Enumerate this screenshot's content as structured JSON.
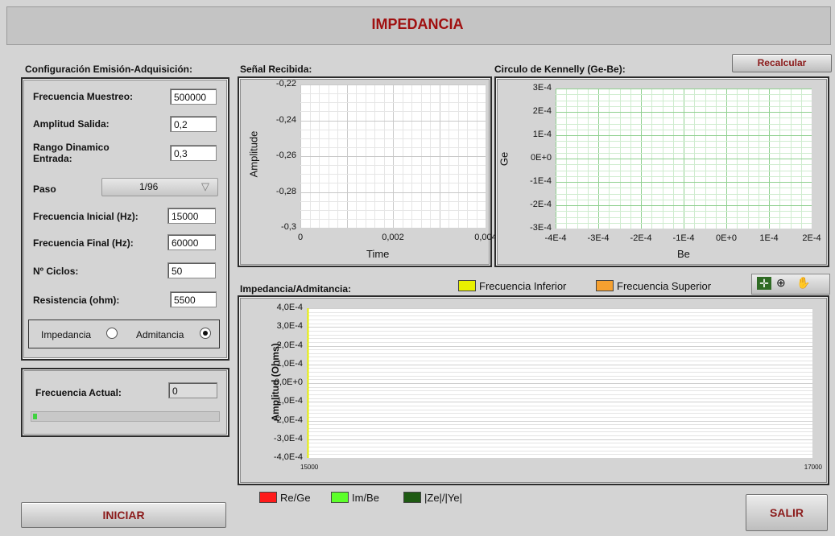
{
  "header": {
    "title": "IMPEDANCIA"
  },
  "config": {
    "title": "Configuración Emisión-Adquisición:",
    "fields": [
      {
        "label": "Frecuencia Muestreo:",
        "value": "500000"
      },
      {
        "label": "Amplitud Salida:",
        "value": "0,2"
      },
      {
        "label": "Rango Dinamico Entrada:",
        "value": "0,3"
      },
      {
        "label": "Paso",
        "value": "1/96"
      },
      {
        "label": "Frecuencia Inicial (Hz):",
        "value": "15000"
      },
      {
        "label": "Frecuencia Final (Hz):",
        "value": "60000"
      },
      {
        "label": "Nº Ciclos:",
        "value": "50"
      },
      {
        "label": "Resistencia (ohm):",
        "value": "5500"
      }
    ],
    "radio_impedancia": "Impedancia",
    "radio_admitancia": "Admitancia",
    "selected_mode": "Admitancia"
  },
  "freq_actual": {
    "label": "Frecuencia Actual:",
    "value": "0",
    "progress": 0.02
  },
  "signal_chart": {
    "title": "Señal Recibida:",
    "ylabel": "Amplitude",
    "xlabel": "Time",
    "yticks": [
      "-0,22",
      "-0,24",
      "-0,26",
      "-0,28",
      "-0,3"
    ],
    "xticks": [
      "0",
      "0,002",
      "0,004"
    ]
  },
  "kennelly_chart": {
    "title": "Circulo de Kennelly (Ge-Be):",
    "ylabel": "Ge",
    "xlabel": "Be",
    "yticks": [
      "3E-4",
      "2E-4",
      "1E-4",
      "0E+0",
      "-1E-4",
      "-2E-4",
      "-3E-4"
    ],
    "xticks": [
      "-4E-4",
      "-3E-4",
      "-2E-4",
      "-1E-4",
      "0E+0",
      "1E-4",
      "2E-4"
    ]
  },
  "recalcular_label": "Recalcular",
  "impedance_chart": {
    "title": "Impedancia/Admitancia:",
    "ylabel": "Amplitud (Ohms)",
    "yticks": [
      "4,0E-4",
      "3,0E-4",
      "2,0E-4",
      "1,0E-4",
      "0,0E+0",
      "-1,0E-4",
      "-2,0E-4",
      "-3,0E-4",
      "-4,0E-4"
    ],
    "xticks": [
      "15000",
      "17000"
    ],
    "legend_top": [
      {
        "name": "Frecuencia Inferior",
        "color": "#e8f000"
      },
      {
        "name": "Frecuencia Superior",
        "color": "#f5a030"
      }
    ],
    "legend_bottom": [
      {
        "name": "Re/Ge",
        "color": "#ff1a1a"
      },
      {
        "name": "Im/Be",
        "color": "#5cff2a"
      },
      {
        "name": "|Ze|/|Ye|",
        "color": "#1e5a12"
      }
    ]
  },
  "chart_data": [
    {
      "type": "line",
      "title": "",
      "xlabel": "Time",
      "ylabel": "Amplitude",
      "xlim": [
        0,
        0.004
      ],
      "ylim": [
        -0.3,
        -0.22
      ],
      "series": [],
      "grid": true
    },
    {
      "type": "scatter",
      "title": "",
      "xlabel": "Be",
      "ylabel": "Ge",
      "xlim": [
        -0.0004,
        0.0002
      ],
      "ylim": [
        -0.0003,
        0.0003
      ],
      "series": [],
      "grid": true
    },
    {
      "type": "line",
      "title": "",
      "xlabel": "",
      "ylabel": "Amplitud (Ohms)",
      "xlim": [
        15000,
        17000
      ],
      "ylim": [
        -0.0004,
        0.0004
      ],
      "series": [],
      "grid": true
    }
  ],
  "buttons": {
    "iniciar": "INICIAR",
    "salir": "SALIR"
  }
}
